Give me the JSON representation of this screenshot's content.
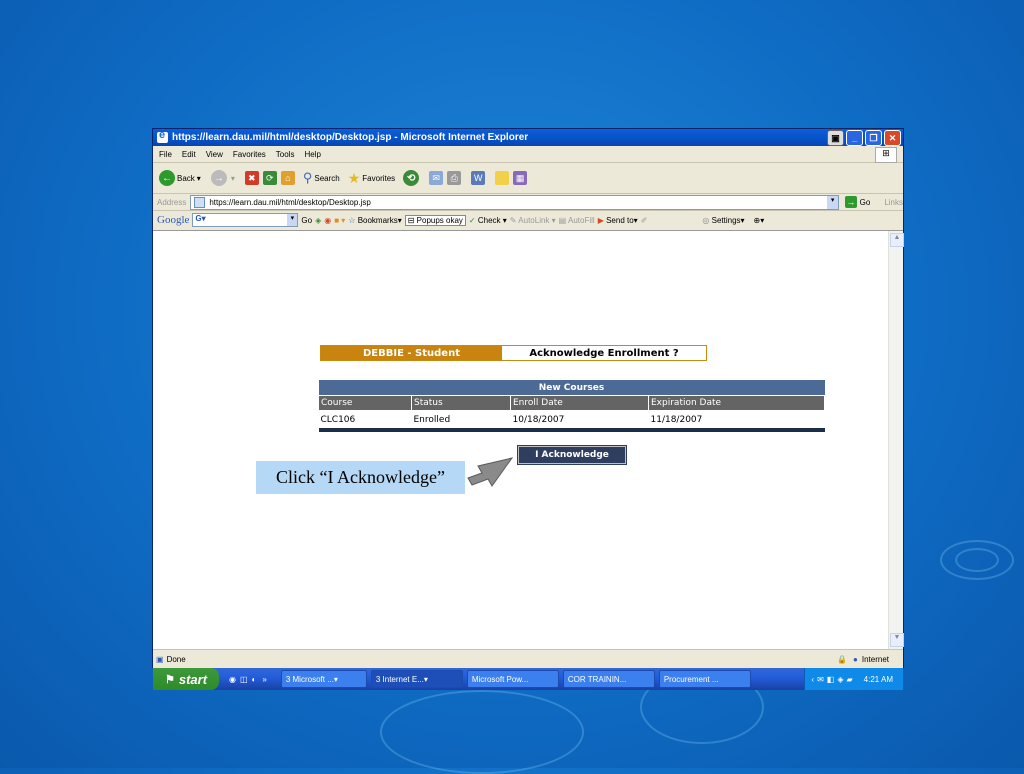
{
  "window": {
    "title": "https://learn.dau.mil/html/desktop/Desktop.jsp - Microsoft Internet Explorer"
  },
  "menubar": [
    "File",
    "Edit",
    "View",
    "Favorites",
    "Tools",
    "Help"
  ],
  "toolbar": {
    "back": "Back",
    "search": "Search",
    "favorites": "Favorites"
  },
  "addressbar": {
    "label": "Address",
    "url": "https://learn.dau.mil/html/desktop/Desktop.jsp",
    "go": "Go",
    "links": "Links"
  },
  "googlebar": {
    "logo": "Google",
    "go": "Go",
    "bookmarks": "Bookmarks",
    "popups": "Popups okay",
    "check": "Check",
    "autolink": "AutoLink",
    "autofill": "AutoFill",
    "sendto": "Send to",
    "settings": "Settings"
  },
  "page": {
    "user": "DEBBIE   - Student",
    "section_title": "Acknowledge Enrollment   ?",
    "table_title": "New Courses",
    "columns": [
      "Course",
      "Status",
      "Enroll Date",
      "Expiration Date"
    ],
    "rows": [
      [
        "CLC106",
        "Enrolled",
        "10/18/2007",
        "11/18/2007"
      ]
    ],
    "ack_button": "I Acknowledge"
  },
  "statusbar": {
    "status": "Done",
    "zone": "Internet"
  },
  "taskbar": {
    "start": "start",
    "tasks": [
      "3 Microsoft ...",
      "3 Internet E...",
      "Microsoft Pow...",
      "COR TRAININ...",
      "Procurement ..."
    ],
    "clock": "4:21 AM"
  },
  "callout": {
    "text": "Click “I Acknowledge”"
  }
}
